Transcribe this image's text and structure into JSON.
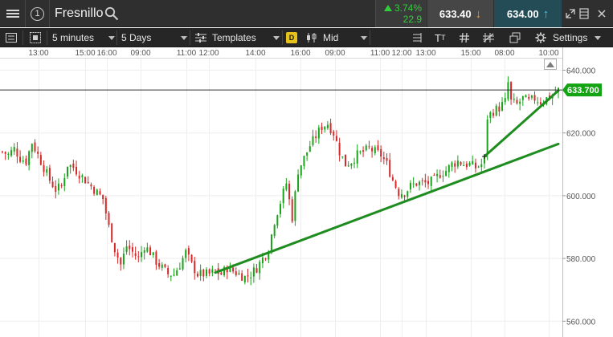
{
  "instrument": {
    "name": "Fresnillo",
    "badge_number": "1"
  },
  "quote": {
    "change_percent": "3.74%",
    "change_points": "22.9",
    "sell_price": "633.40",
    "buy_price": "634.00"
  },
  "toolbar": {
    "interval": "5 minutes",
    "range": "5 Days",
    "templates_label": "Templates",
    "price_badge": "D",
    "price_type": "Mid",
    "text_tool": "T",
    "settings_label": "Settings"
  },
  "colors": {
    "accent_green": "#2fcf3a",
    "trendline": "#1e8c1e",
    "current_price_tag": "#13a313",
    "sell_arrow": "#f0a020",
    "buy_arrow": "#4fc4e6"
  },
  "icons": [
    "menu-icon",
    "search-icon",
    "restore-icon",
    "close-icon",
    "grid-icon",
    "candlestick-icon",
    "indicator-icon",
    "draw-icon",
    "layers-icon",
    "settings-gear-icon",
    "scroll-up-icon"
  ],
  "chart_data": {
    "type": "candlestick",
    "y_ticks": [
      "640.000",
      "620.000",
      "600.000",
      "580.000",
      "560.000"
    ],
    "y_range": [
      560,
      643
    ],
    "current_price": "633.700",
    "x_tick_labels": [
      "13:00",
      "15:00",
      "16:00",
      "09:00",
      "11:00",
      "12:00",
      "14:00",
      "16:00",
      "09:00",
      "11:00",
      "12:00",
      "13:00",
      "15:00",
      "08:00",
      "10:00"
    ],
    "grid": true,
    "trendlines": [
      {
        "from": [
          72,
          575.5
        ],
        "to": [
          188,
          616.5
        ]
      },
      {
        "from": [
          163,
          612.5
        ],
        "to": [
          188,
          633.5
        ]
      }
    ],
    "close_path": [
      [
        0,
        614
      ],
      [
        2,
        613
      ],
      [
        4,
        615
      ],
      [
        6,
        612
      ],
      [
        8,
        611
      ],
      [
        10,
        617
      ],
      [
        12,
        613
      ],
      [
        14,
        609
      ],
      [
        16,
        605
      ],
      [
        18,
        602
      ],
      [
        20,
        603
      ],
      [
        22,
        610
      ],
      [
        24,
        609
      ],
      [
        26,
        607
      ],
      [
        28,
        605
      ],
      [
        30,
        603
      ],
      [
        32,
        601
      ],
      [
        34,
        599
      ],
      [
        36,
        590
      ],
      [
        38,
        583
      ],
      [
        40,
        578
      ],
      [
        42,
        584
      ],
      [
        44,
        582
      ],
      [
        46,
        580
      ],
      [
        48,
        584
      ],
      [
        50,
        582
      ],
      [
        52,
        579
      ],
      [
        54,
        577
      ],
      [
        56,
        575
      ],
      [
        58,
        575
      ],
      [
        60,
        578
      ],
      [
        62,
        582
      ],
      [
        64,
        578
      ],
      [
        66,
        575
      ],
      [
        68,
        575
      ],
      [
        70,
        575
      ],
      [
        72,
        576
      ],
      [
        74,
        575
      ],
      [
        76,
        577
      ],
      [
        78,
        576
      ],
      [
        80,
        575
      ],
      [
        82,
        574
      ],
      [
        84,
        575
      ],
      [
        86,
        577
      ],
      [
        88,
        580
      ],
      [
        90,
        583
      ],
      [
        92,
        592
      ],
      [
        94,
        598
      ],
      [
        96,
        604
      ],
      [
        98,
        593
      ],
      [
        100,
        608
      ],
      [
        102,
        612
      ],
      [
        104,
        616
      ],
      [
        106,
        619
      ],
      [
        108,
        622
      ],
      [
        110,
        623
      ],
      [
        112,
        620
      ],
      [
        114,
        614
      ],
      [
        116,
        610
      ],
      [
        118,
        611
      ],
      [
        120,
        613
      ],
      [
        122,
        614
      ],
      [
        124,
        615
      ],
      [
        126,
        614
      ],
      [
        128,
        613
      ],
      [
        130,
        610
      ],
      [
        132,
        605
      ],
      [
        134,
        601
      ],
      [
        136,
        601
      ],
      [
        138,
        603
      ],
      [
        140,
        604
      ],
      [
        142,
        604
      ],
      [
        144,
        604
      ],
      [
        146,
        605
      ],
      [
        148,
        607
      ],
      [
        150,
        608
      ],
      [
        152,
        610
      ],
      [
        154,
        611
      ],
      [
        156,
        610
      ],
      [
        158,
        610
      ],
      [
        160,
        609
      ],
      [
        162,
        610
      ],
      [
        163,
        612
      ],
      [
        164,
        625
      ],
      [
        166,
        627
      ],
      [
        168,
        628
      ],
      [
        170,
        630
      ],
      [
        171,
        636
      ],
      [
        172,
        630
      ],
      [
        174,
        629
      ],
      [
        176,
        631
      ],
      [
        178,
        630
      ],
      [
        180,
        631
      ],
      [
        182,
        630
      ],
      [
        184,
        631
      ],
      [
        186,
        632
      ],
      [
        188,
        633.7
      ]
    ]
  }
}
